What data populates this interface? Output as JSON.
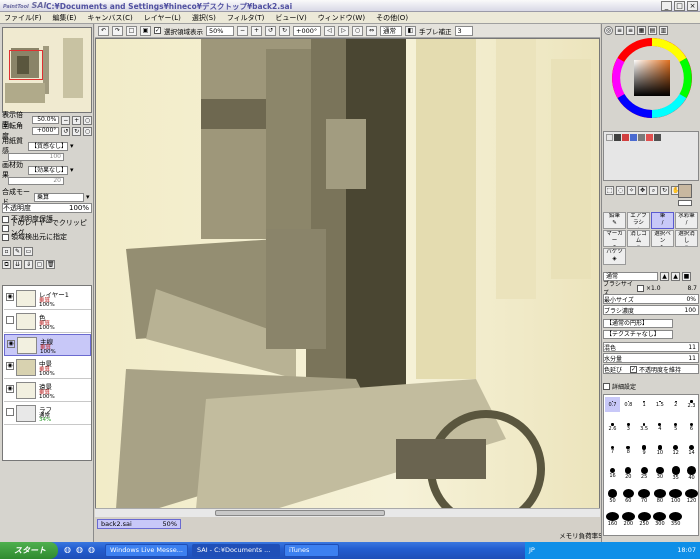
{
  "app": {
    "logo": "SAI",
    "logo_small": "PaintTool",
    "title": "C:¥Documents and Settings¥hineco¥デスクトップ¥back2.sai",
    "window_buttons": [
      "_",
      "□",
      "×"
    ]
  },
  "menu": [
    "ファイル(F)",
    "編集(E)",
    "キャンバス(C)",
    "レイヤー(L)",
    "選択(S)",
    "フィルタ(T)",
    "ビュー(V)",
    "ウィンドウ(W)",
    "その他(O)"
  ],
  "toolbar": {
    "selection_display": "選択領域表示",
    "zoom": "50%",
    "rotation": "+000°",
    "mode": "通常",
    "stabilizer_label": "手ブレ補正",
    "stabilizer_value": "3"
  },
  "left": {
    "zoom_label": "表示倍率",
    "zoom_value": "50.0%",
    "rotate_label": "回転角度",
    "rotate_value": "+000°",
    "paper_label": "用紙質感",
    "paper_value": "【質感なし】",
    "paper_strength": "100",
    "effect_label": "画材効果",
    "effect_value": "【効果なし】",
    "effect_strength": "20",
    "blend_label": "合成モード",
    "blend_value": "乗算",
    "opacity_label": "不透明度",
    "opacity_value": "100%",
    "opt1": "不透明度保護",
    "opt2": "下のレイヤーでクリッピング",
    "opt3": "領域検出元に指定",
    "layers": [
      {
        "name": "レイヤー1",
        "mode": "乗算",
        "opacity": "100%"
      },
      {
        "name": "色",
        "mode": "乗算",
        "opacity": "100%"
      },
      {
        "name": "主線",
        "mode": "乗算",
        "opacity": "100%"
      },
      {
        "name": "中景",
        "mode": "乗算",
        "opacity": "100%"
      },
      {
        "name": "遠景",
        "mode": "乗算",
        "opacity": "100%"
      },
      {
        "name": "ラフ",
        "mode": "通常",
        "opacity": "34%"
      }
    ]
  },
  "document_tab": {
    "name": "back2.sai",
    "zoom": "50%"
  },
  "status": {
    "text": "メモリ負荷率58% (436MB使用/1015MB確保)"
  },
  "right": {
    "tools": [
      {
        "label": "鉛筆"
      },
      {
        "label": "エアブラシ"
      },
      {
        "label": "筆"
      },
      {
        "label": "水彩筆"
      },
      {
        "label": "マーカー"
      },
      {
        "label": "消しゴム"
      },
      {
        "label": "選択ペン"
      },
      {
        "label": "選択消し"
      },
      {
        "label": "バケツ"
      }
    ],
    "brush_mode": "通常",
    "brush_size_label": "ブラシサイズ",
    "brush_size_mult": "×1.0",
    "brush_size_value": "8.7",
    "min_size_label": "最小サイズ",
    "min_size_value": "0%",
    "density_label": "ブラシ濃度",
    "density_value": "100",
    "shape_value": "【通常の円形】",
    "texture_value": "【テクスチャなし】",
    "mix_label": "混色",
    "mix_value": "11",
    "water_label": "水分量",
    "water_value": "11",
    "stretch_label": "色延び",
    "stretch_value": "0",
    "keep_opacity": "不透明度を維持",
    "detail": "詳細設定",
    "brush_sizes": [
      "0.7",
      "0.8",
      "1",
      "1.5",
      "2",
      "2.3",
      "2.6",
      "3",
      "3.5",
      "4",
      "5",
      "6",
      "7",
      "8",
      "9",
      "10",
      "12",
      "14",
      "16",
      "20",
      "25",
      "30",
      "35",
      "40",
      "50",
      "60",
      "70",
      "80",
      "100",
      "120",
      "160",
      "200",
      "250",
      "300",
      "350"
    ],
    "color_swatches": [
      "#e6e6e6",
      "#ffffff",
      "#404040",
      "#d24040",
      "#4a6ad0",
      "#7a7a7a",
      "#e05050",
      "#505050"
    ],
    "accent_color": "#6a6ad0"
  },
  "taskbar": {
    "start": "スタート",
    "tasks": [
      "Windows Live Messe...",
      "SAI - C:¥Documents ...",
      "iTunes"
    ],
    "tray_lang": "JP",
    "clock": "18:07"
  }
}
